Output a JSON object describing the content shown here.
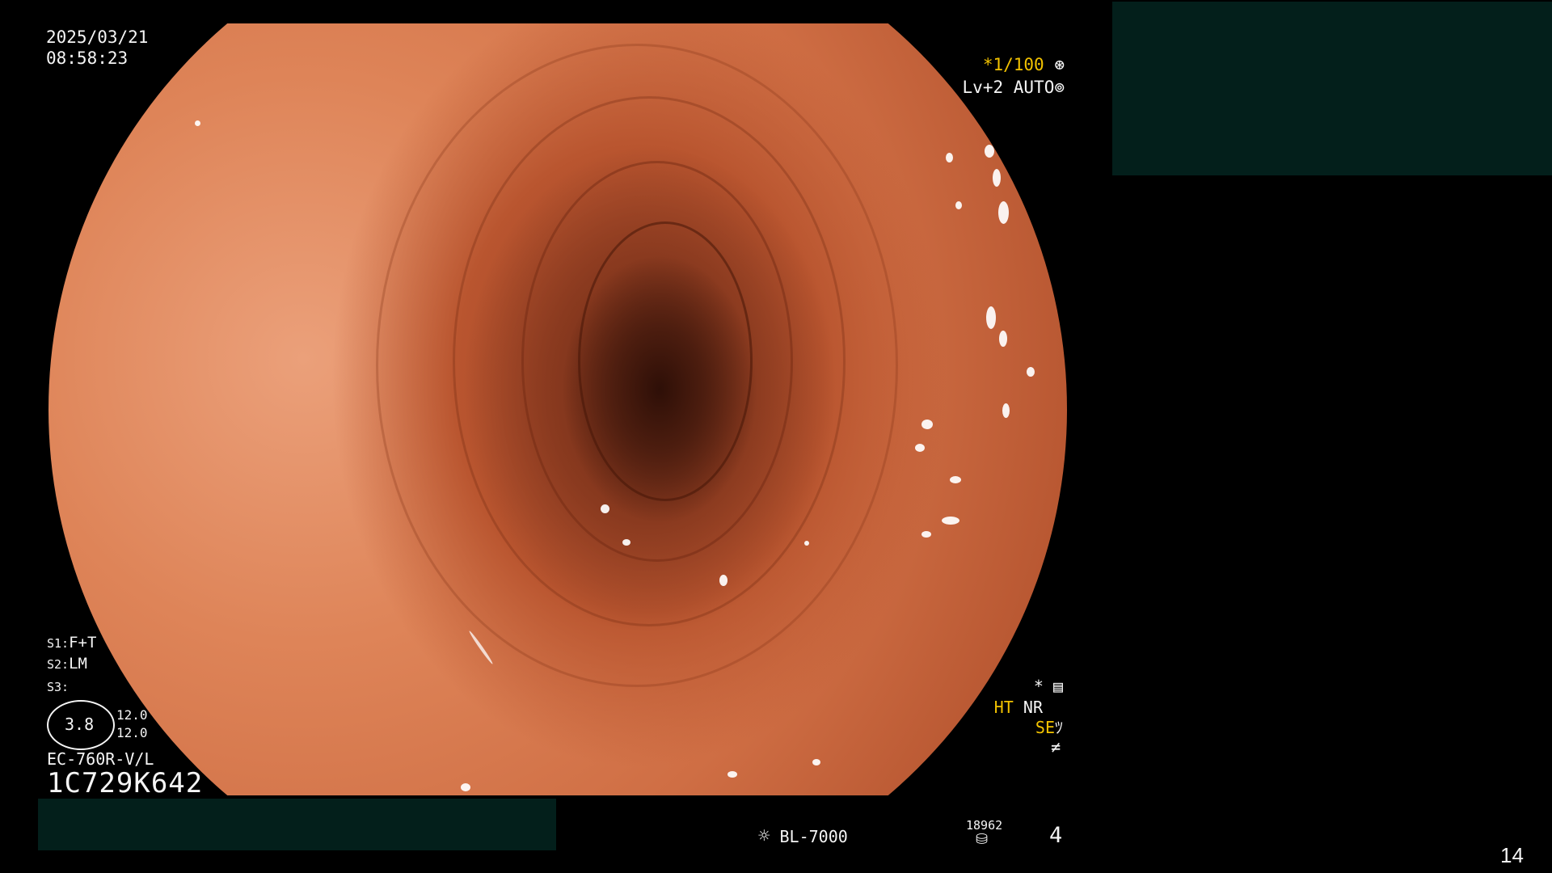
{
  "timestamp": {
    "date": "2025/03/21",
    "time": "08:58:23"
  },
  "shutter": {
    "marker": "*",
    "value": "1/100",
    "icon": "aperture-icon"
  },
  "exposure": {
    "level": "Lv+2",
    "mode": "AUTO",
    "icon": "exposure-icon"
  },
  "scope_settings": {
    "s1": {
      "label": "S1:",
      "value": "F+T"
    },
    "s2": {
      "label": "S2:",
      "value": "LM"
    },
    "s3": {
      "label": "S3:",
      "value": ""
    }
  },
  "scope_dial": {
    "value": "3.8",
    "upper": "12.0",
    "lower": "12.0"
  },
  "scope_model": "EC-760R-V/L",
  "scope_serial": "1C729K642",
  "processing": {
    "star": "*",
    "ht": "HT",
    "nr": "NR",
    "se": "SE",
    "icons": [
      "mode-icon",
      "brightness-icon",
      "freeze-icon"
    ]
  },
  "light_source": {
    "name": "BL-7000",
    "icon": "lamp-icon"
  },
  "counter": {
    "value": "18962",
    "icon": "storage-icon"
  },
  "capture_count": "4",
  "page_number": "14",
  "colors": {
    "background": "#000000",
    "text": "#f5f5f5",
    "highlight": "#f2c200",
    "redaction": "#031f1b"
  }
}
